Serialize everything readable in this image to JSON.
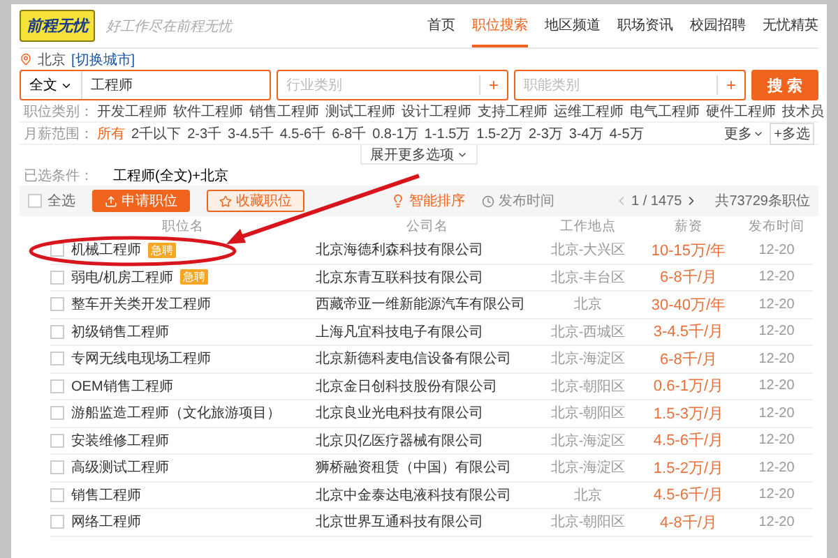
{
  "header": {
    "logo": "前程无忧",
    "slogan": "好工作尽在前程无忧",
    "nav": [
      {
        "label": "首页",
        "selected": false
      },
      {
        "label": "职位搜索",
        "selected": true
      },
      {
        "label": "地区频道",
        "selected": false
      },
      {
        "label": "职场资讯",
        "selected": false
      },
      {
        "label": "校园招聘",
        "selected": false
      },
      {
        "label": "无忧精英",
        "selected": false
      }
    ]
  },
  "location": {
    "city": "北京",
    "switch_link": "[切换城市]"
  },
  "search": {
    "scope": "全文",
    "keyword": "工程师",
    "industry": {
      "placeholder": "行业类别",
      "add": "+"
    },
    "function": {
      "placeholder": "职能类别",
      "add": "+"
    },
    "button": "搜 索"
  },
  "filters": [
    {
      "label": "职位类别：",
      "options": [
        {
          "label": "开发工程师",
          "selected": false
        },
        {
          "label": "软件工程师",
          "selected": false
        },
        {
          "label": "销售工程师",
          "selected": false
        },
        {
          "label": "测试工程师",
          "selected": false
        },
        {
          "label": "设计工程师",
          "selected": false
        },
        {
          "label": "支持工程师",
          "selected": false
        },
        {
          "label": "运维工程师",
          "selected": false
        },
        {
          "label": "电气工程师",
          "selected": false
        },
        {
          "label": "硬件工程师",
          "selected": false
        },
        {
          "label": "技术员",
          "selected": false
        }
      ]
    },
    {
      "label": "月薪范围：",
      "more": "更多",
      "multi": "+多选",
      "options": [
        {
          "label": "所有",
          "selected": true
        },
        {
          "label": "2千以下",
          "selected": false
        },
        {
          "label": "2-3千",
          "selected": false
        },
        {
          "label": "3-4.5千",
          "selected": false
        },
        {
          "label": "4.5-6千",
          "selected": false
        },
        {
          "label": "6-8千",
          "selected": false
        },
        {
          "label": "0.8-1万",
          "selected": false
        },
        {
          "label": "1-1.5万",
          "selected": false
        },
        {
          "label": "1.5-2万",
          "selected": false
        },
        {
          "label": "2-3万",
          "selected": false
        },
        {
          "label": "3-4万",
          "selected": false
        },
        {
          "label": "4-5万",
          "selected": false
        }
      ]
    }
  ],
  "expand": "展开更多选项",
  "selected_conditions": {
    "label": "已选条件：",
    "value": "工程师(全文)+北京"
  },
  "toolbar": {
    "select_all": {
      "label": "全选",
      "checked": false
    },
    "apply": "申请职位",
    "favorite": "收藏职位",
    "sort": "智能排序",
    "time": "发布时间",
    "page": "1 / 1475",
    "total": "共73729条职位"
  },
  "table": {
    "columns": [
      "职位名",
      "公司名",
      "工作地点",
      "薪资",
      "发布时间"
    ],
    "rows": [
      {
        "title": "机械工程师",
        "badge": "急聘",
        "company": "北京海德利森科技有限公司",
        "location": "北京-大兴区",
        "salary": "10-15万/年",
        "date": "12-20",
        "checked": false
      },
      {
        "title": "弱电/机房工程师",
        "badge": "急聘",
        "company": "北京东青互联科技有限公司",
        "location": "北京-丰台区",
        "salary": "6-8千/月",
        "date": "12-20",
        "checked": false
      },
      {
        "title": "整车开关类开发工程师",
        "company": "西藏帝亚一维新能源汽车有限公司",
        "location": "北京",
        "salary": "30-40万/年",
        "date": "12-20",
        "checked": false
      },
      {
        "title": "初级销售工程师",
        "company": "上海凡宜科技电子有限公司",
        "location": "北京-西城区",
        "salary": "3-4.5千/月",
        "date": "12-20",
        "checked": false
      },
      {
        "title": "专网无线电现场工程师",
        "company": "北京新德科麦电信设备有限公司",
        "location": "北京-海淀区",
        "salary": "6-8千/月",
        "date": "12-20",
        "checked": false
      },
      {
        "title": "OEM销售工程师",
        "company": "北京金日创科技股份有限公司",
        "location": "北京-朝阳区",
        "salary": "0.6-1万/月",
        "date": "12-20",
        "checked": false
      },
      {
        "title": "游船监造工程师（文化旅游项目）",
        "company": "北京良业光电科技有限公司",
        "location": "北京-朝阳区",
        "salary": "1.5-3万/月",
        "date": "12-20",
        "checked": false
      },
      {
        "title": "安装维修工程师",
        "company": "北京贝亿医疗器械有限公司",
        "location": "北京-海淀区",
        "salary": "4.5-6千/月",
        "date": "12-20",
        "checked": false
      },
      {
        "title": "高级测试工程师",
        "company": "狮桥融资租赁（中国）有限公司",
        "location": "北京-海淀区",
        "salary": "1.5-2万/月",
        "date": "12-20",
        "checked": false
      },
      {
        "title": "销售工程师",
        "company": "北京中金泰达电液科技有限公司",
        "location": "北京",
        "salary": "4.5-6千/月",
        "date": "12-20",
        "checked": false
      },
      {
        "title": "网络工程师",
        "company": "北京世界互通科技有限公司",
        "location": "北京-朝阳区",
        "salary": "4-8千/月",
        "date": "12-20",
        "checked": false
      }
    ]
  }
}
